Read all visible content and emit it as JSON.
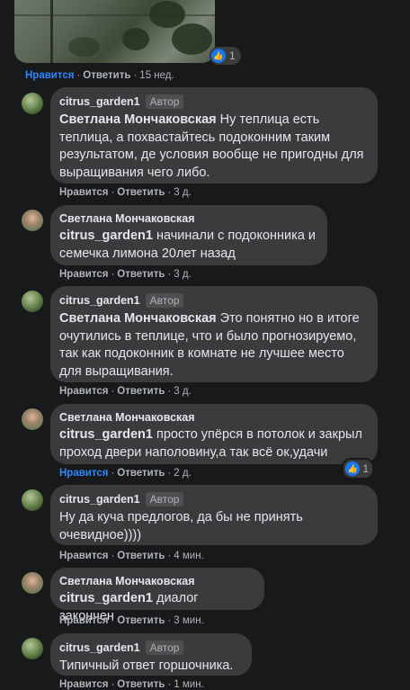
{
  "actions": {
    "like": "Нравится",
    "reply": "Ответить",
    "separator": "·"
  },
  "top_post": {
    "time": "15 нед.",
    "reaction_count": "1",
    "liked": true
  },
  "comments": [
    {
      "author": "citrus_garden1",
      "badge": "Автор",
      "mention": "Светлана Мончаковская",
      "text": "Ну теплица есть теплица, а похвастайтесь подоконним таким результатом, де условия вообще не пригодны для выращивания чего либо.",
      "time": "3 д."
    },
    {
      "author": "Светлана Мончаковская",
      "mention": "citrus_garden1",
      "text": "начинали с подоконника и семечка лимона 20лет назад",
      "time": "3 д."
    },
    {
      "author": "citrus_garden1",
      "badge": "Автор",
      "mention": "Светлана Мончаковская",
      "text": "Это понятно но в итоге очутились в теплице, что и было прогнозируемо, так как подоконник в комнате не лучшее место для выращивания.",
      "time": "3 д."
    },
    {
      "author": "Светлана Мончаковская",
      "mention": "citrus_garden1",
      "text": "просто упёрся в потолок и закрыл проход двери наполовину,а так всё ок,удачи",
      "time": "2 д.",
      "liked": true,
      "reaction_count": "1"
    },
    {
      "author": "citrus_garden1",
      "badge": "Автор",
      "text": "Ну да куча предлогов, да бы не принять очевидное))))",
      "time": "4 мин."
    },
    {
      "author": "Светлана Мончаковская",
      "mention": "citrus_garden1",
      "text": "диалог закончен",
      "time": "3 мин."
    },
    {
      "author": "citrus_garden1",
      "badge": "Автор",
      "text": "Типичный ответ горшочника.",
      "time": "1 мин."
    }
  ],
  "colors": {
    "background": "#18191a",
    "bubble": "#3a3b3c",
    "text": "#e4e6eb",
    "secondary": "#b0b3b8",
    "liked": "#2d88ff",
    "like_badge": "#1877f2"
  }
}
